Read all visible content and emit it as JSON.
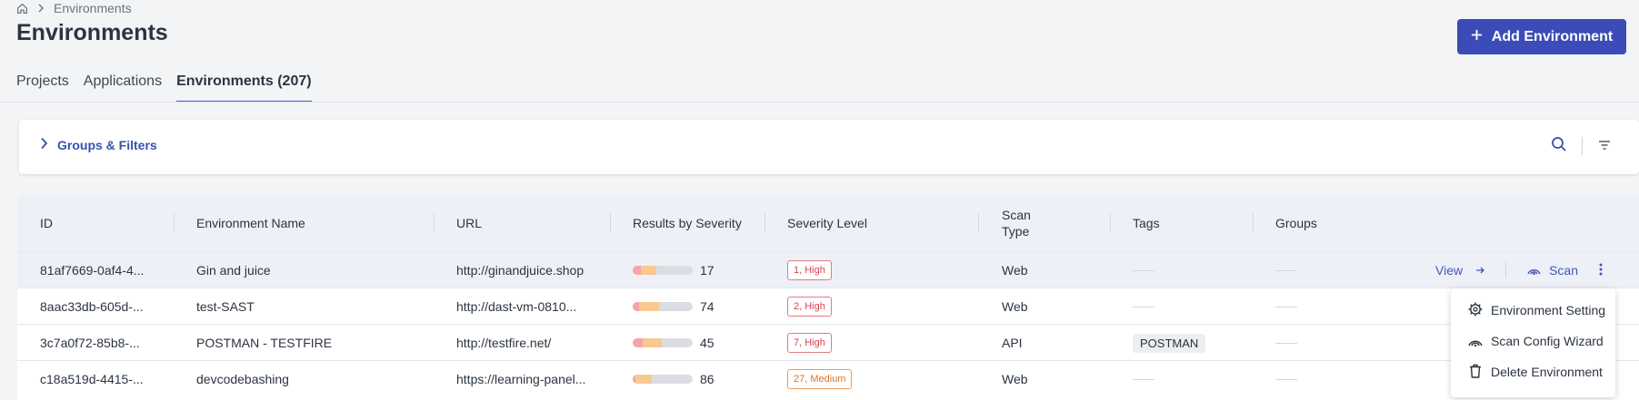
{
  "breadcrumb": {
    "current": "Environments"
  },
  "page": {
    "title": "Environments",
    "add_button": "Add Environment"
  },
  "tabs": [
    {
      "label": "Projects",
      "active": false
    },
    {
      "label": "Applications",
      "active": false
    },
    {
      "label": "Environments (207)",
      "active": true
    }
  ],
  "filters": {
    "label": "Groups & Filters"
  },
  "table": {
    "columns": [
      "ID",
      "Environment Name",
      "URL",
      "Results by Severity",
      "Severity Level",
      "Scan Type",
      "Tags",
      "Groups"
    ],
    "rows": [
      {
        "id": "81af7669-0af4-4...",
        "name": "Gin and juice",
        "url": "http://ginandjuice.shop",
        "count": "17",
        "severity": "1, High",
        "severity_kind": "high",
        "scan_type": "Web",
        "tag": "",
        "sev_parts": [
          0.13,
          0.27
        ]
      },
      {
        "id": "8aac33db-605d-...",
        "name": "test-SAST",
        "url": "http://dast-vm-0810...",
        "count": "74",
        "severity": "2, High",
        "severity_kind": "high",
        "scan_type": "Web",
        "tag": "",
        "sev_parts": [
          0.1,
          0.34
        ]
      },
      {
        "id": "3c7a0f72-85b8-...",
        "name": "POSTMAN - TESTFIRE",
        "url": "http://testfire.net/",
        "count": "45",
        "severity": "7, High",
        "severity_kind": "high",
        "scan_type": "API",
        "tag": "POSTMAN",
        "sev_parts": [
          0.16,
          0.32
        ]
      },
      {
        "id": "c18a519d-4415-...",
        "name": "devcodebashing",
        "url": "https://learning-panel...",
        "count": "86",
        "severity": "27, Medium",
        "severity_kind": "medium",
        "scan_type": "Web",
        "tag": "",
        "sev_parts": [
          0.04,
          0.28
        ]
      }
    ],
    "actions": {
      "view": "View",
      "scan": "Scan"
    }
  },
  "context_menu": {
    "items": [
      "Environment Setting",
      "Scan Config Wizard",
      "Delete Environment"
    ]
  },
  "colors": {
    "accent": "#3b4cb8",
    "link": "#4257b2",
    "high": "#d9434f",
    "medium": "#dd7522",
    "critical_seg": "#f6a3ad",
    "high_seg": "#f8c98f"
  }
}
